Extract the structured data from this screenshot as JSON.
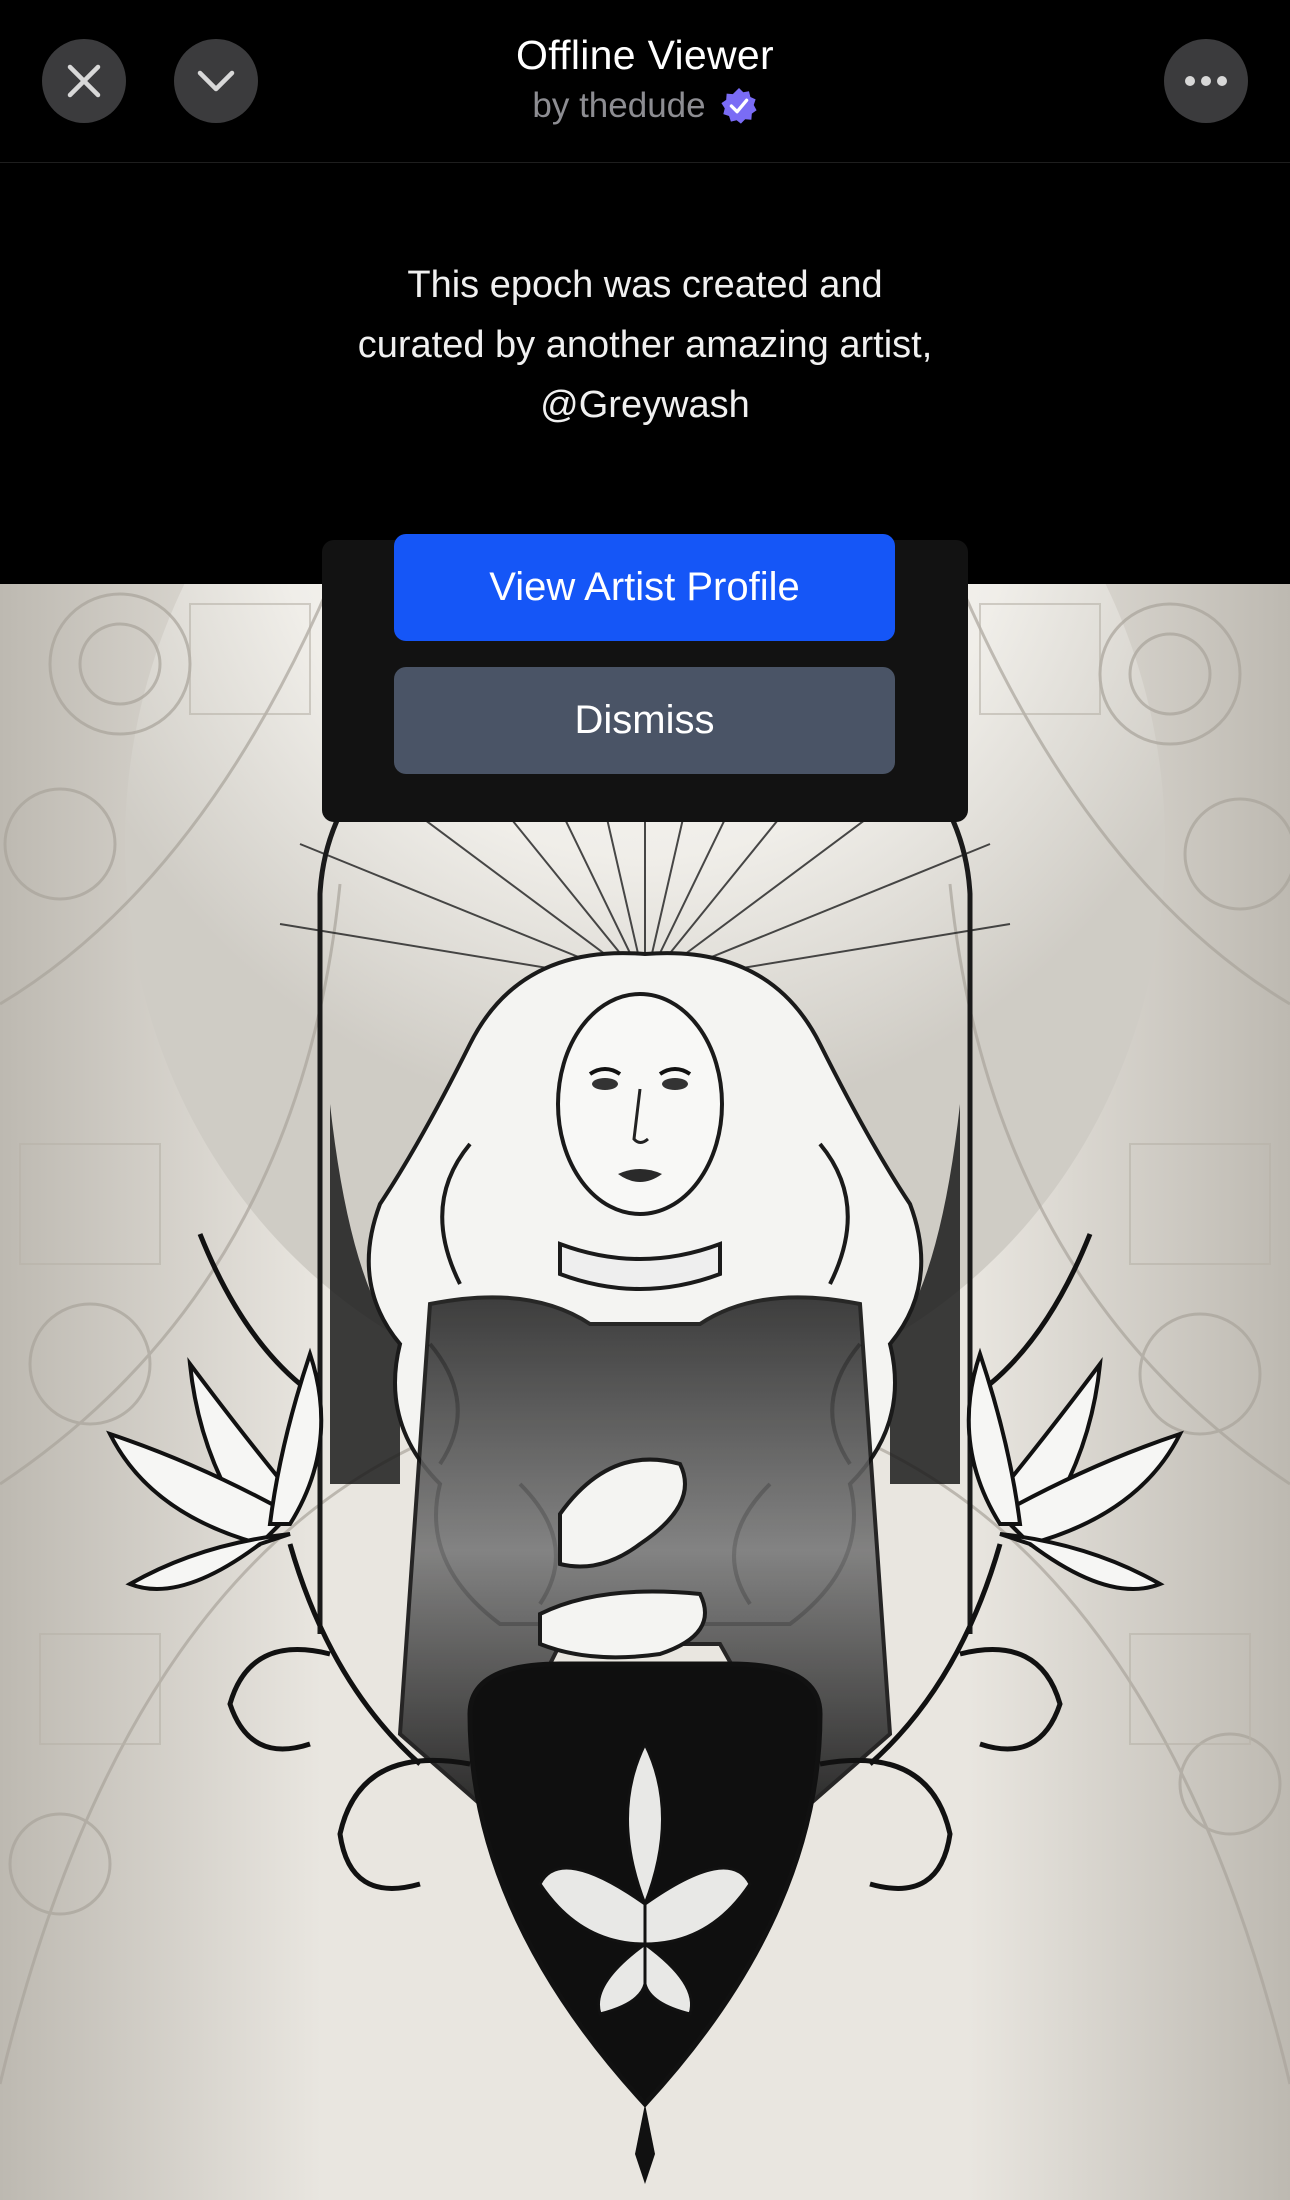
{
  "header": {
    "title": "Offline Viewer",
    "subtitle": "by thedude",
    "close_icon": "close-icon",
    "collapse_icon": "chevron-down-icon",
    "more_icon": "more-horizontal-icon",
    "verified_icon": "verified-badge-icon",
    "verified_color": "#7a6cf5"
  },
  "banner": {
    "message": "This epoch was created and curated by another amazing artist, @Greywash"
  },
  "dialog": {
    "primary_label": "View Artist Profile",
    "secondary_label": "Dismiss",
    "primary_color": "#1556f7",
    "secondary_color": "#4a5466"
  }
}
